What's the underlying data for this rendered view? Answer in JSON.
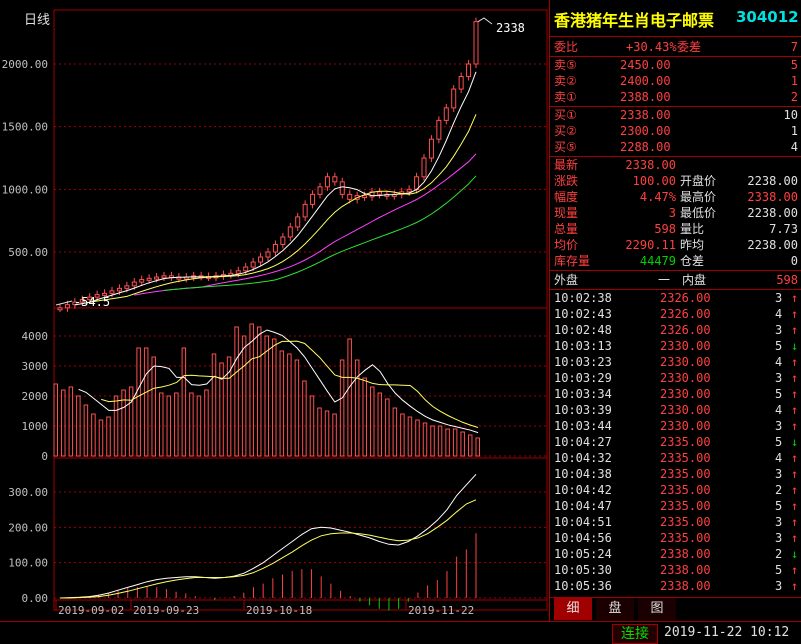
{
  "chart_data": {
    "type": "line",
    "period_label": "日线",
    "price_axis_ticks": [
      2000,
      1500,
      1000,
      500
    ],
    "price_axis_labels": [
      "2000.00",
      "1500.00",
      "1000.00",
      "500.00"
    ],
    "max_label": "2338",
    "min_label": "54.5",
    "volume_axis_labels": [
      "4000",
      "3000",
      "2000",
      "1000",
      "0"
    ],
    "indicator_axis_labels": [
      "300.00",
      "200.00",
      "100.00",
      "0.00"
    ],
    "x_labels": [
      "2019-09-02",
      "2019-09-23",
      "2019-10-18",
      "2019-11-22"
    ],
    "candles_close": [
      54.5,
      80,
      100,
      120,
      140,
      160,
      170,
      190,
      210,
      230,
      260,
      280,
      290,
      300,
      310,
      300,
      290,
      300,
      310,
      305,
      300,
      310,
      320,
      330,
      350,
      380,
      420,
      460,
      500,
      560,
      620,
      700,
      780,
      880,
      960,
      1020,
      1100,
      1060,
      960,
      920,
      950,
      940,
      980,
      960,
      950,
      960,
      980,
      1000,
      1100,
      1250,
      1400,
      1550,
      1650,
      1800,
      1900,
      2000,
      2338
    ],
    "volume": [
      2400,
      2200,
      2300,
      2000,
      1700,
      1400,
      1200,
      1300,
      2000,
      2200,
      2300,
      3600,
      3600,
      3300,
      2100,
      2000,
      2100,
      3600,
      2100,
      2000,
      2200,
      3400,
      3100,
      3300,
      4300,
      4000,
      4400,
      4300,
      4000,
      3900,
      3500,
      3400,
      3200,
      2500,
      2000,
      1600,
      1500,
      1400,
      3200,
      3900,
      3200,
      2600,
      2300,
      2100,
      1900,
      1600,
      1400,
      1300,
      1200,
      1100,
      1000,
      1000,
      900,
      900,
      800,
      700,
      600
    ]
  },
  "quote": {
    "name": "香港猪年生肖电子邮票",
    "code": "304012",
    "weibi_label": "委比",
    "weibi_value": "+30.43%",
    "weicha_label": "委差",
    "weicha_value": "7",
    "asks": [
      {
        "label": "卖⑤",
        "price": "2450.00",
        "vol": "5"
      },
      {
        "label": "卖②",
        "price": "2400.00",
        "vol": "1"
      },
      {
        "label": "卖①",
        "price": "2388.00",
        "vol": "2"
      }
    ],
    "bids": [
      {
        "label": "买①",
        "price": "2338.00",
        "vol": "10"
      },
      {
        "label": "买②",
        "price": "2300.00",
        "vol": "1"
      },
      {
        "label": "买⑤",
        "price": "2288.00",
        "vol": "4"
      }
    ],
    "stats": [
      {
        "l1": "最新",
        "v1": "2338.00",
        "l2": "",
        "v2": ""
      },
      {
        "l1": "涨跌",
        "v1": "100.00",
        "l2": "开盘价",
        "v2": "2238.00"
      },
      {
        "l1": "幅度",
        "v1": "4.47%",
        "l2": "最高价",
        "v2": "2338.00"
      },
      {
        "l1": "现量",
        "v1": "3",
        "l2": "最低价",
        "v2": "2238.00"
      },
      {
        "l1": "总量",
        "v1": "598",
        "l2": "量比",
        "v2": "7.73"
      },
      {
        "l1": "均价",
        "v1": "2290.11",
        "l2": "昨均",
        "v2": "2238.00"
      },
      {
        "l1": "库存量",
        "v1": "44479",
        "l2": "仓差",
        "v2": "0"
      }
    ],
    "outer_label": "外盘",
    "outer_value": "一",
    "inner_label": "内盘",
    "inner_value": "598"
  },
  "trades": [
    {
      "t": "10:02:38",
      "p": "2326.00",
      "v": "3",
      "d": "↑"
    },
    {
      "t": "10:02:43",
      "p": "2326.00",
      "v": "4",
      "d": "↑"
    },
    {
      "t": "10:02:48",
      "p": "2326.00",
      "v": "3",
      "d": "↑"
    },
    {
      "t": "10:03:13",
      "p": "2330.00",
      "v": "5",
      "d": "↓"
    },
    {
      "t": "10:03:23",
      "p": "2330.00",
      "v": "4",
      "d": "↑"
    },
    {
      "t": "10:03:29",
      "p": "2330.00",
      "v": "3",
      "d": "↑"
    },
    {
      "t": "10:03:34",
      "p": "2330.00",
      "v": "5",
      "d": "↑"
    },
    {
      "t": "10:03:39",
      "p": "2330.00",
      "v": "4",
      "d": "↑"
    },
    {
      "t": "10:03:44",
      "p": "2330.00",
      "v": "3",
      "d": "↑"
    },
    {
      "t": "10:04:27",
      "p": "2335.00",
      "v": "5",
      "d": "↓"
    },
    {
      "t": "10:04:32",
      "p": "2335.00",
      "v": "4",
      "d": "↑"
    },
    {
      "t": "10:04:38",
      "p": "2335.00",
      "v": "3",
      "d": "↑"
    },
    {
      "t": "10:04:42",
      "p": "2335.00",
      "v": "2",
      "d": "↑"
    },
    {
      "t": "10:04:47",
      "p": "2335.00",
      "v": "5",
      "d": "↑"
    },
    {
      "t": "10:04:51",
      "p": "2335.00",
      "v": "3",
      "d": "↑"
    },
    {
      "t": "10:04:56",
      "p": "2335.00",
      "v": "3",
      "d": "↑"
    },
    {
      "t": "10:05:24",
      "p": "2338.00",
      "v": "2",
      "d": "↓"
    },
    {
      "t": "10:05:30",
      "p": "2338.00",
      "v": "5",
      "d": "↑"
    },
    {
      "t": "10:05:36",
      "p": "2338.00",
      "v": "3",
      "d": "↑"
    }
  ],
  "tabs": [
    "细",
    "盘",
    "图"
  ],
  "status": {
    "connect": "连接",
    "datetime": "2019-11-22  10:12"
  }
}
